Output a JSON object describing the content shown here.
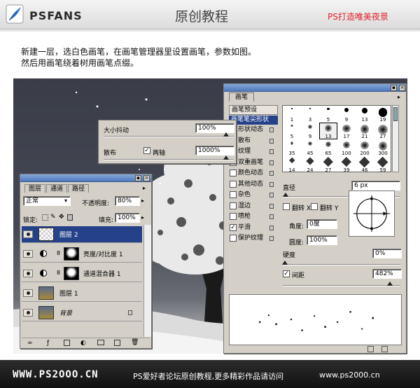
{
  "header": {
    "brand": "PSFANS",
    "title": "原创教程",
    "slogan": "PS打造唯美夜景"
  },
  "instructions": [
    "新建一层，选白色画笔，在画笔管理器里设置画笔，参数如图。",
    "然后用画笔绕着树用画笔点缀。"
  ],
  "popup": {
    "size_jitter_label": "大小抖动",
    "size_jitter_value": "100%",
    "scatter_label": "散布",
    "both_axes_label": "两轴",
    "scatter_value": "1000%"
  },
  "brush_panel": {
    "tab": "画笔",
    "presets_button": "画笔预设",
    "items": [
      {
        "label": "画笔笔尖形状",
        "checkbox": false,
        "checked": false,
        "selected": true
      },
      {
        "label": "形状动态",
        "checkbox": true,
        "checked": true,
        "selected": false
      },
      {
        "label": "散布",
        "checkbox": true,
        "checked": true,
        "selected": false
      },
      {
        "label": "纹理",
        "checkbox": true,
        "checked": false,
        "selected": false
      },
      {
        "label": "双重画笔",
        "checkbox": true,
        "checked": false,
        "selected": false
      },
      {
        "label": "颜色动态",
        "checkbox": true,
        "checked": false,
        "selected": false
      },
      {
        "label": "其他动态",
        "checkbox": true,
        "checked": false,
        "selected": false
      },
      {
        "label": "杂色",
        "checkbox": true,
        "checked": false,
        "selected": false
      },
      {
        "label": "湿边",
        "checkbox": true,
        "checked": false,
        "selected": false
      },
      {
        "label": "喷枪",
        "checkbox": true,
        "checked": false,
        "selected": false
      },
      {
        "label": "平滑",
        "checkbox": true,
        "checked": true,
        "selected": false
      },
      {
        "label": "保护纹理",
        "checkbox": true,
        "checked": false,
        "selected": false
      }
    ],
    "brush_sizes": [
      "1",
      "3",
      "5",
      "9",
      "13",
      "19",
      "5",
      "9",
      "13",
      "17",
      "21",
      "27",
      "35",
      "45",
      "65",
      "100",
      "200",
      "300",
      "14",
      "24",
      "27",
      "39",
      "46",
      "59"
    ],
    "selected_brush": "13",
    "diameter_label": "直径",
    "diameter_value": "6 px",
    "flip_x_label": "翻转 X",
    "flip_y_label": "翻转 Y",
    "angle_label": "角度:",
    "angle_value": "0度",
    "roundness_label": "圆度:",
    "roundness_value": "100%",
    "hardness_label": "硬度",
    "hardness_value": "0%",
    "spacing_label": "间距",
    "spacing_value": "482%",
    "spacing_checked": true
  },
  "layers_panel": {
    "tabs": [
      "图层",
      "通道",
      "路径"
    ],
    "blend_mode": "正常",
    "opacity_label": "不透明度:",
    "opacity_value": "80%",
    "lock_label": "锁定:",
    "fill_label": "填充:",
    "fill_value": "100%",
    "layers": [
      {
        "name": "图层 2",
        "selected": true
      },
      {
        "name": "亮度/对比度 1",
        "selected": false
      },
      {
        "name": "通道混合器 1",
        "selected": false
      },
      {
        "name": "图层 1",
        "selected": false
      },
      {
        "name": "背景",
        "selected": false
      }
    ]
  },
  "footer": {
    "left": "WWW.PS2OOO.CN",
    "middle": "PS爱好者论坛原创教程,更多精彩作品请访问",
    "right": "www.ps2000.cn"
  }
}
